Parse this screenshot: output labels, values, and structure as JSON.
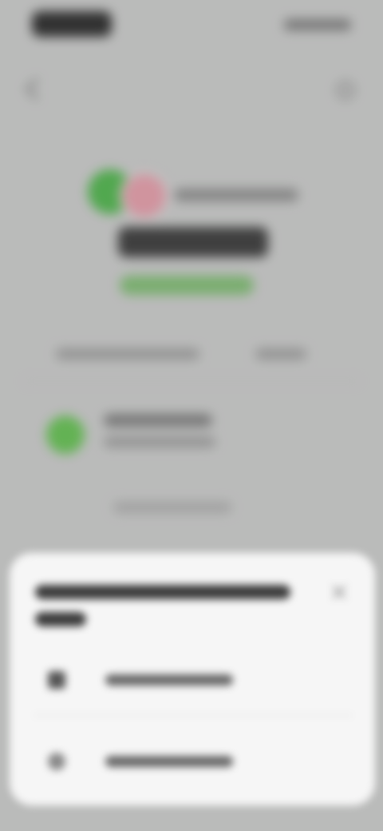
{
  "status_bar": {
    "time": "",
    "icons": [
      "signal-icon",
      "wifi-icon",
      "battery-icon"
    ]
  },
  "header": {
    "back_icon": "chevron-left-icon",
    "action_icon": "info-icon"
  },
  "asset": {
    "pair_label": "",
    "balance": "",
    "change": ""
  },
  "tabs": [
    {
      "label": ""
    },
    {
      "label": ""
    }
  ],
  "list": {
    "item": {
      "title": "",
      "subtitle": "",
      "line3": ""
    }
  },
  "sheet": {
    "title": "",
    "close_icon": "close-icon",
    "options": [
      {
        "icon": "device-icon",
        "label": ""
      },
      {
        "icon": "circle-icon",
        "label": ""
      }
    ]
  },
  "colors": {
    "accent_green": "#49b246",
    "accent_pink": "#e39aa7",
    "sheet_bg": "#f6f6f6",
    "page_bg": "#c9cac9"
  }
}
